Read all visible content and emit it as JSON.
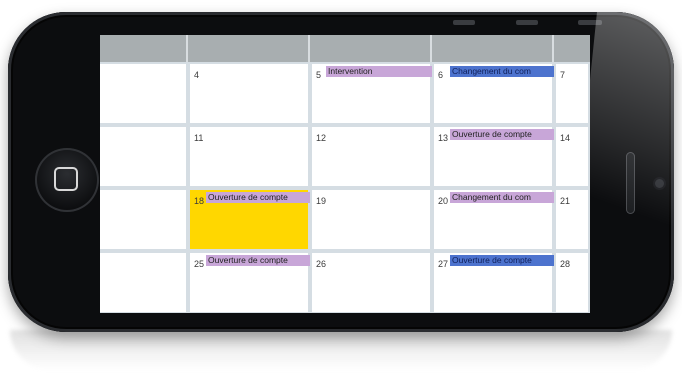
{
  "calendar": {
    "weeks": [
      {
        "days": [
          {
            "num": "",
            "event": ""
          },
          {
            "num": "4",
            "event": ""
          },
          {
            "num": "5",
            "event": "Intervention",
            "event_color": "purple"
          },
          {
            "num": "6",
            "event": "Changement du com",
            "event_color": "blue"
          },
          {
            "num": "7",
            "event": ""
          }
        ]
      },
      {
        "days": [
          {
            "num": "",
            "event": ""
          },
          {
            "num": "11",
            "event": ""
          },
          {
            "num": "12",
            "event": ""
          },
          {
            "num": "13",
            "event": "Ouverture de compte",
            "event_color": "purple"
          },
          {
            "num": "14",
            "event": ""
          }
        ]
      },
      {
        "days": [
          {
            "num": "",
            "event": ""
          },
          {
            "num": "18",
            "event": "Ouverture de compte",
            "event_color": "purple",
            "highlighted": true
          },
          {
            "num": "19",
            "event": ""
          },
          {
            "num": "20",
            "event": "Changement du com",
            "event_color": "purple"
          },
          {
            "num": "21",
            "event": ""
          }
        ]
      },
      {
        "days": [
          {
            "num": "",
            "event": ""
          },
          {
            "num": "25",
            "event": "Ouverture de compte",
            "event_color": "purple"
          },
          {
            "num": "26",
            "event": ""
          },
          {
            "num": "27",
            "event": "Ouverture de compte",
            "event_color": "blue"
          },
          {
            "num": "28",
            "event": ""
          }
        ]
      }
    ]
  },
  "colors": {
    "header": "#a8aeb0",
    "today": "#ffd700",
    "event_purple": "#c8a6d8",
    "event_blue": "#4d73ce",
    "cell_border": "#d5dde3"
  },
  "icons": {
    "home": "home-button-icon",
    "speaker": "speaker-grille",
    "camera": "front-camera"
  }
}
